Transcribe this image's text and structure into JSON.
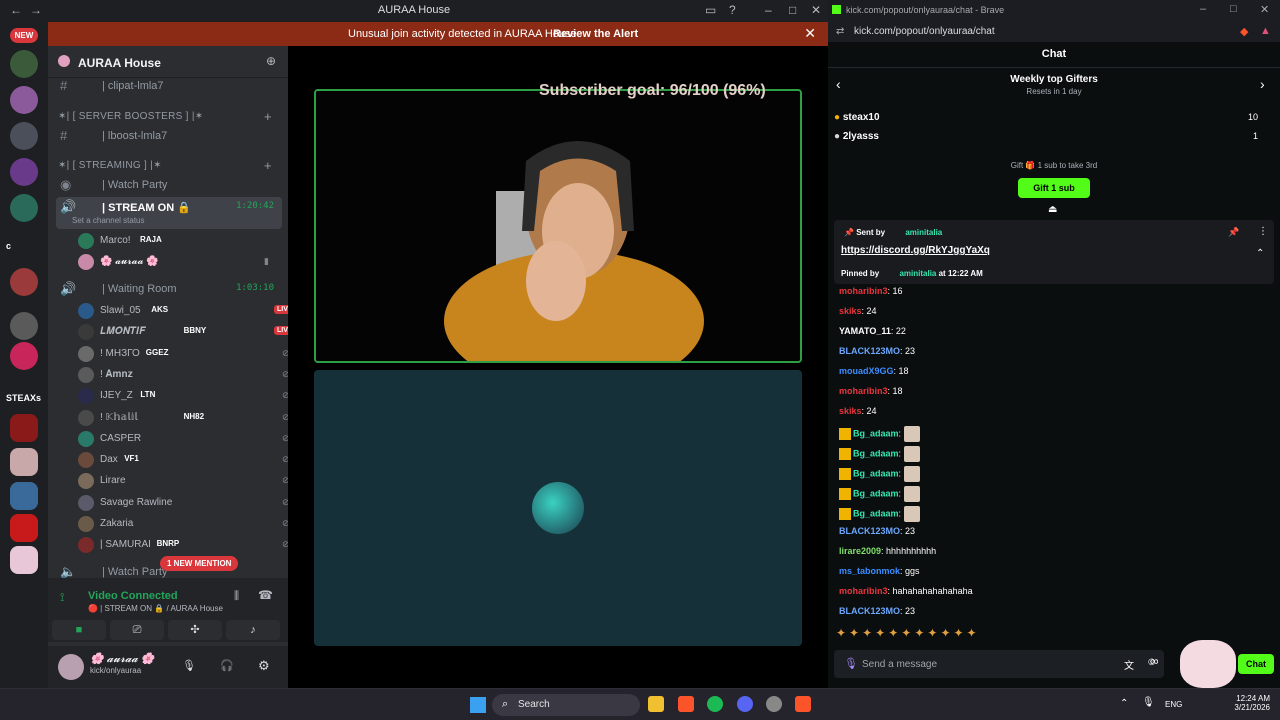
{
  "discord": {
    "window_title": "AURAA House",
    "banner": {
      "text": "Unusual join activity detected in AURAA House",
      "action": "Review the Alert"
    },
    "servers": {
      "new_badge": "NEW",
      "steax_label": "STEAXs",
      "c_label": "c"
    },
    "guild_name": "AURAA House",
    "channels_top": [
      {
        "label": "| clipat-lmla7"
      }
    ],
    "categories": [
      {
        "label": "✶| [ SERVER BOOSTERS ] |✶"
      },
      {
        "label": "✶| [ STREAMING ] |✶"
      }
    ],
    "boost_channel": "| lboost-lmla7",
    "watch_party": "| Watch Party",
    "stream_on": {
      "label": "| STREAM ON 🔒",
      "time": "1:20:42",
      "status": "Set a channel status"
    },
    "stream_users": [
      {
        "name": "Marco!",
        "tag": "RAJA"
      },
      {
        "name": "🌸 𝓪𝓾𝓻𝓪𝓪 🌸",
        "tag": ""
      }
    ],
    "waiting_room": {
      "label": "| Waiting Room",
      "time": "1:03:10"
    },
    "waiting_users": [
      {
        "name": "Slawi_05",
        "tag": "AKS",
        "live": "LIVE"
      },
      {
        "name": "𝑳𝑴𝑶𝑵𝑻𝑰𝑭",
        "tag": "BBNY",
        "live": "LIVE"
      },
      {
        "name": "! МНЗГО",
        "tag": "GGEZ",
        "live": ""
      },
      {
        "name": "! 𝐀𝐦𝐧𝐳",
        "tag": "",
        "live": ""
      },
      {
        "name": "IJEY_Z",
        "tag": "LTN",
        "live": ""
      },
      {
        "name": "! 𝕂𝕙𝕒𝕝𝕚𝕝",
        "tag": "NH82",
        "live": ""
      },
      {
        "name": "CASPER",
        "tag": "",
        "live": ""
      },
      {
        "name": "Dax",
        "tag": "VF1",
        "live": ""
      },
      {
        "name": "Lirare",
        "tag": "",
        "live": ""
      },
      {
        "name": "Savage Rawline",
        "tag": "",
        "live": ""
      },
      {
        "name": "Zakaria",
        "tag": "",
        "live": ""
      },
      {
        "name": "| SAMURAI",
        "tag": "BNRP",
        "live": ""
      }
    ],
    "watch_party_bottom": "| Watch Party",
    "mention_badge": "1 NEW MENTION",
    "voice": {
      "title": "Video Connected",
      "sub": "🔴 | STREAM ON 🔒 / AURAA House"
    },
    "user": {
      "name": "🌸 𝓪𝓾𝓻𝓪𝓪 🌸",
      "sub": "kick/onlyauraa"
    },
    "subscriber_goal": "Subscriber goal: 96/100 (96%)"
  },
  "browser": {
    "title": "kick.com/popout/onlyauraa/chat - Brave",
    "url": "kick.com/popout/onlyauraa/chat",
    "chat_header": "Chat",
    "gifters_title": "Weekly top Gifters",
    "gifters_sub": "Resets in 1 day",
    "gifters": [
      {
        "name": "steax10",
        "count": "10"
      },
      {
        "name": "2lyasss",
        "count": "1"
      }
    ],
    "gift_hint": "Gift 🎁 1 sub to take 3rd",
    "gift_button": "Gift 1 sub",
    "pinned": {
      "sent_by": "Sent by",
      "sender": "aminitalia",
      "link": "https://discord.gg/RkYJggYaXq",
      "pinned_by": "Pinned by",
      "pinner": "aminitalia",
      "pinned_time": "at 12:22 AM"
    },
    "messages": [
      {
        "user": "moharibin3",
        "text": ": 16",
        "color": "#e8363c"
      },
      {
        "user": "skiks",
        "text": ": 24",
        "color": "#e8363c"
      },
      {
        "user": "YAMATO_11",
        "text": ": 22",
        "color": "#ffffff"
      },
      {
        "user": "BLACK123MO",
        "text": ": 23",
        "color": "#6aa7ff"
      },
      {
        "user": "mouadX9GG",
        "text": ": 18",
        "color": "#3b8dff"
      },
      {
        "user": "moharibin3",
        "text": ": 18",
        "color": "#e8363c"
      },
      {
        "user": "skiks",
        "text": ": 24",
        "color": "#e8363c"
      },
      {
        "user": "Bg_adaam",
        "text": ":",
        "color": "#36e8b0"
      },
      {
        "user": "Bg_adaam",
        "text": ":",
        "color": "#36e8b0"
      },
      {
        "user": "Bg_adaam",
        "text": ":",
        "color": "#36e8b0"
      },
      {
        "user": "Bg_adaam",
        "text": ":",
        "color": "#36e8b0"
      },
      {
        "user": "Bg_adaam",
        "text": ":",
        "color": "#36e8b0"
      },
      {
        "user": "BLACK123MO",
        "text": ": 23",
        "color": "#6aa7ff"
      },
      {
        "user": "lirare2009",
        "text": ": hhhhhhhhhh",
        "color": "#7ee06a"
      },
      {
        "user": "ms_tabonmok",
        "text": ": ggs",
        "color": "#3b8dff"
      },
      {
        "user": "moharibin3",
        "text": ": hahahahahahahaha",
        "color": "#e8363c"
      },
      {
        "user": "BLACK123MO",
        "text": ": 23",
        "color": "#6aa7ff"
      }
    ],
    "send_placeholder": "Send a message",
    "chat_button": "Chat"
  },
  "taskbar": {
    "search": "Search",
    "lang": "ENG",
    "time": "12:24 AM",
    "date": "3/21/2026"
  }
}
